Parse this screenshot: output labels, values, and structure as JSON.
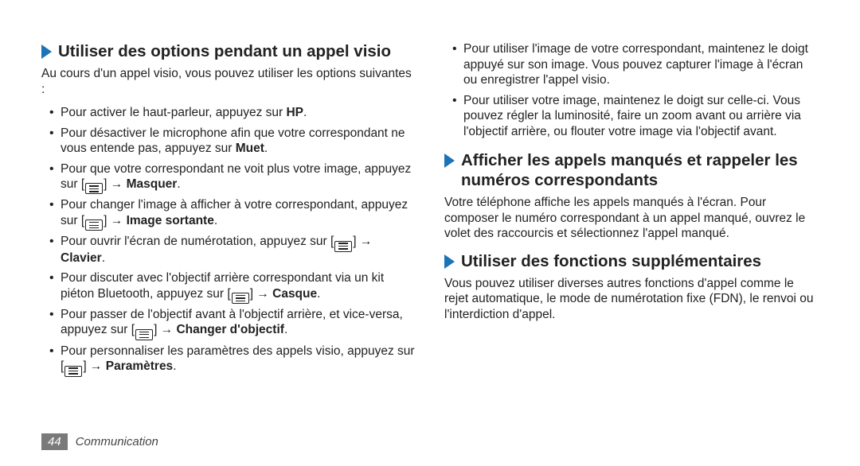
{
  "footer": {
    "page": "44",
    "section": "Communication"
  },
  "left": {
    "h1": "Utiliser des options pendant un appel visio",
    "intro": "Au cours d'un appel visio, vous pouvez utiliser les options suivantes :",
    "items": {
      "i0a": "Pour activer le haut-parleur, appuyez sur ",
      "i0b": "HP",
      "i0c": ".",
      "i1a": "Pour désactiver le microphone afin que votre correspondant ne vous entende pas, appuyez sur ",
      "i1b": "Muet",
      "i1c": ".",
      "i2a": "Pour que votre correspondant ne voit plus votre image, appuyez sur [",
      "i2b": "] → ",
      "i2c": "Masquer",
      "i2d": ".",
      "i3a": "Pour changer l'image à afficher à votre correspondant, appuyez sur [",
      "i3b": "] → ",
      "i3c": "Image sortante",
      "i3d": ".",
      "i4a": "Pour ouvrir l'écran de numérotation, appuyez sur [",
      "i4b": "] → ",
      "i4c": "Clavier",
      "i4d": ".",
      "i5a": "Pour discuter avec l'objectif arrière correspondant via un kit piéton Bluetooth, appuyez sur [",
      "i5b": "] → ",
      "i5c": "Casque",
      "i5d": ".",
      "i6a": "Pour passer de l'objectif avant à l'objectif arrière, et vice-versa, appuyez sur [",
      "i6b": "] → ",
      "i6c": "Changer d'objectif",
      "i6d": ".",
      "i7a": "Pour personnaliser les paramètres des appels visio, appuyez sur [",
      "i7b": "] → ",
      "i7c": "Paramètres",
      "i7d": "."
    }
  },
  "right": {
    "top_items": {
      "t0": "Pour utiliser l'image de votre correspondant, maintenez le doigt appuyé sur son image. Vous pouvez capturer l'image à l'écran ou enregistrer l'appel visio.",
      "t1": "Pour utiliser votre image, maintenez le doigt sur celle-ci. Vous pouvez régler la luminosité, faire un zoom avant ou arrière via l'objectif arrière, ou flouter votre image via l'objectif avant."
    },
    "h2": "Afficher les appels manqués et rappeler les numéros correspondants",
    "p2": "Votre téléphone affiche les appels manqués à l'écran. Pour composer le numéro correspondant à un appel manqué, ouvrez le volet des raccourcis et sélectionnez l'appel manqué.",
    "h3": "Utiliser des fonctions supplémentaires",
    "p3": "Vous pouvez utiliser diverses autres fonctions d'appel comme le rejet automatique, le mode de numérotation fixe (FDN), le renvoi ou l'interdiction d'appel."
  }
}
